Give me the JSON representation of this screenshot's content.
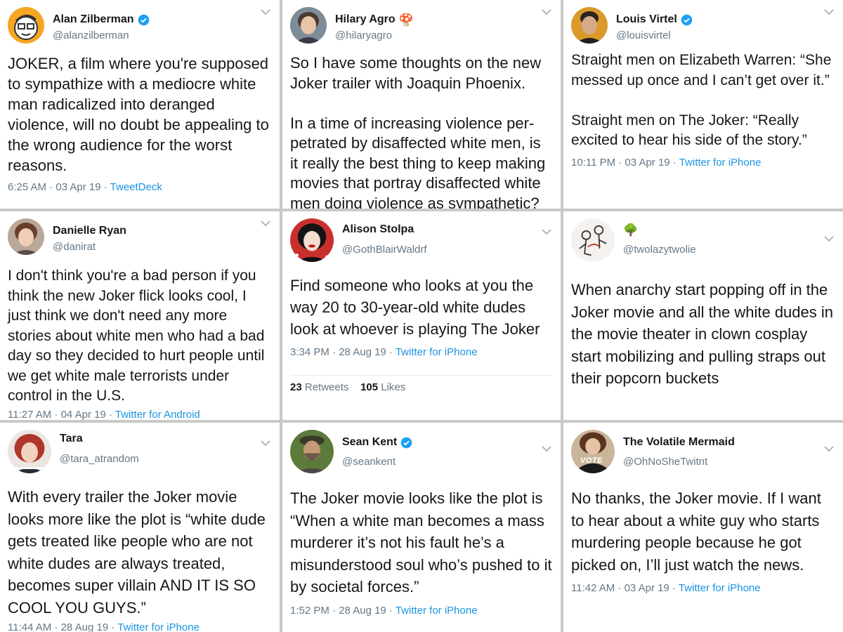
{
  "tweets": [
    {
      "name": "Alan Zilberman",
      "handle": "@alanzilberman",
      "verified": true,
      "avatar_icon": "cartoon-face-avatar",
      "text": "JOKER, a film where you're supposed to sympathize with a mediocre white man radicalized into deranged violence, will no doubt be appealing to the wrong audience for the worst reasons.",
      "time": "6:25 AM · 03 Apr 19 · ",
      "source": "TweetDeck"
    },
    {
      "name": "Hilary Agro",
      "handle": "@hilaryagro",
      "name_emoji": "🍄",
      "avatar_icon": "woman-portrait-avatar",
      "text": "So I have some thoughts on the new Joker trailer with Joaquin Phoenix.\n\nIn a time of increasing violence per-petrated by disaffected white men, is it really the best thing to keep making movies that portray disaffected white men doing violence as sympathetic?"
    },
    {
      "name": "Louis Virtel",
      "handle": "@louisvirtel",
      "verified": true,
      "avatar_icon": "man-portrait-avatar",
      "text": "Straight men on Elizabeth Warren: “She messed up once and I can’t get over it.”\n\nStraight men on The Joker: “Really excited to hear his side of the story.”",
      "time": "10:11 PM · 03 Apr 19 · ",
      "source": "Twitter for iPhone"
    },
    {
      "name": "Danielle Ryan",
      "handle": "@danirat",
      "avatar_icon": "woman-portrait-avatar",
      "text": "I don't think you're a bad person if you think the new Joker flick looks cool, I just think we don't need any more stories about white men who had a bad day so they decided to hurt people until we get white male terrorists under control in the U.S.",
      "time": "11:27 AM · 04 Apr 19 · ",
      "source": "Twitter for Android"
    },
    {
      "name": "Alison Stolpa",
      "handle": "@GothBlairWaldrf",
      "avatar_icon": "woman-red-lips-avatar",
      "text": "Find someone who looks at you the way 20 to 30-year-old white dudes look at whoever is playing The Joker",
      "time": "3:34 PM · 28 Aug 19 · ",
      "source": "Twitter for iPhone",
      "retweets": "23",
      "retweets_label": " Retweets",
      "likes": "105",
      "likes_label": " Likes"
    },
    {
      "name": "🌳",
      "handle": "@twolazytwolie",
      "avatar_icon": "line-drawing-avatar",
      "text": "When anarchy start popping off in the Joker movie and all the white dudes in the movie theater in clown cosplay start mobilizing and pulling straps out their popcorn buckets"
    },
    {
      "name": "Tara",
      "handle": "@tara_atrandom",
      "avatar_icon": "red-hair-woman-avatar",
      "text": "With every trailer the Joker movie looks more like the plot is “white dude gets treated like people who are not white dudes are always treated, becomes super villain AND IT IS SO COOL YOU GUYS.”",
      "time": "11:44 AM · 28 Aug 19 · ",
      "source": "Twitter for iPhone"
    },
    {
      "name": "Sean Kent",
      "handle": "@seankent",
      "verified": true,
      "avatar_icon": "bearded-man-avatar",
      "text": "The Joker movie looks like the plot is “When a white man becomes a mass murderer it’s not his fault he’s a misunderstood soul who’s pushed to it by societal forces.”",
      "time": "1:52 PM · 28 Aug 19 · ",
      "source": "Twitter for iPhone"
    },
    {
      "name": "The Volatile Mermaid",
      "handle": "@OhNoSheTwitnt",
      "avatar_icon": "vote-shirt-avatar",
      "avatar_text": "VOTE",
      "text": "No thanks, the Joker movie. If I want to hear about a white guy who starts murdering people because he got picked on, I’ll just watch the news.",
      "time": "11:42 AM · 03 Apr 19 · ",
      "source": "Twitter for iPhone"
    }
  ],
  "colors": {
    "text": "#14171a",
    "muted": "#657786",
    "link": "#1b95e0",
    "verified": "#1da1f2",
    "divider": "#c9c9c9"
  }
}
